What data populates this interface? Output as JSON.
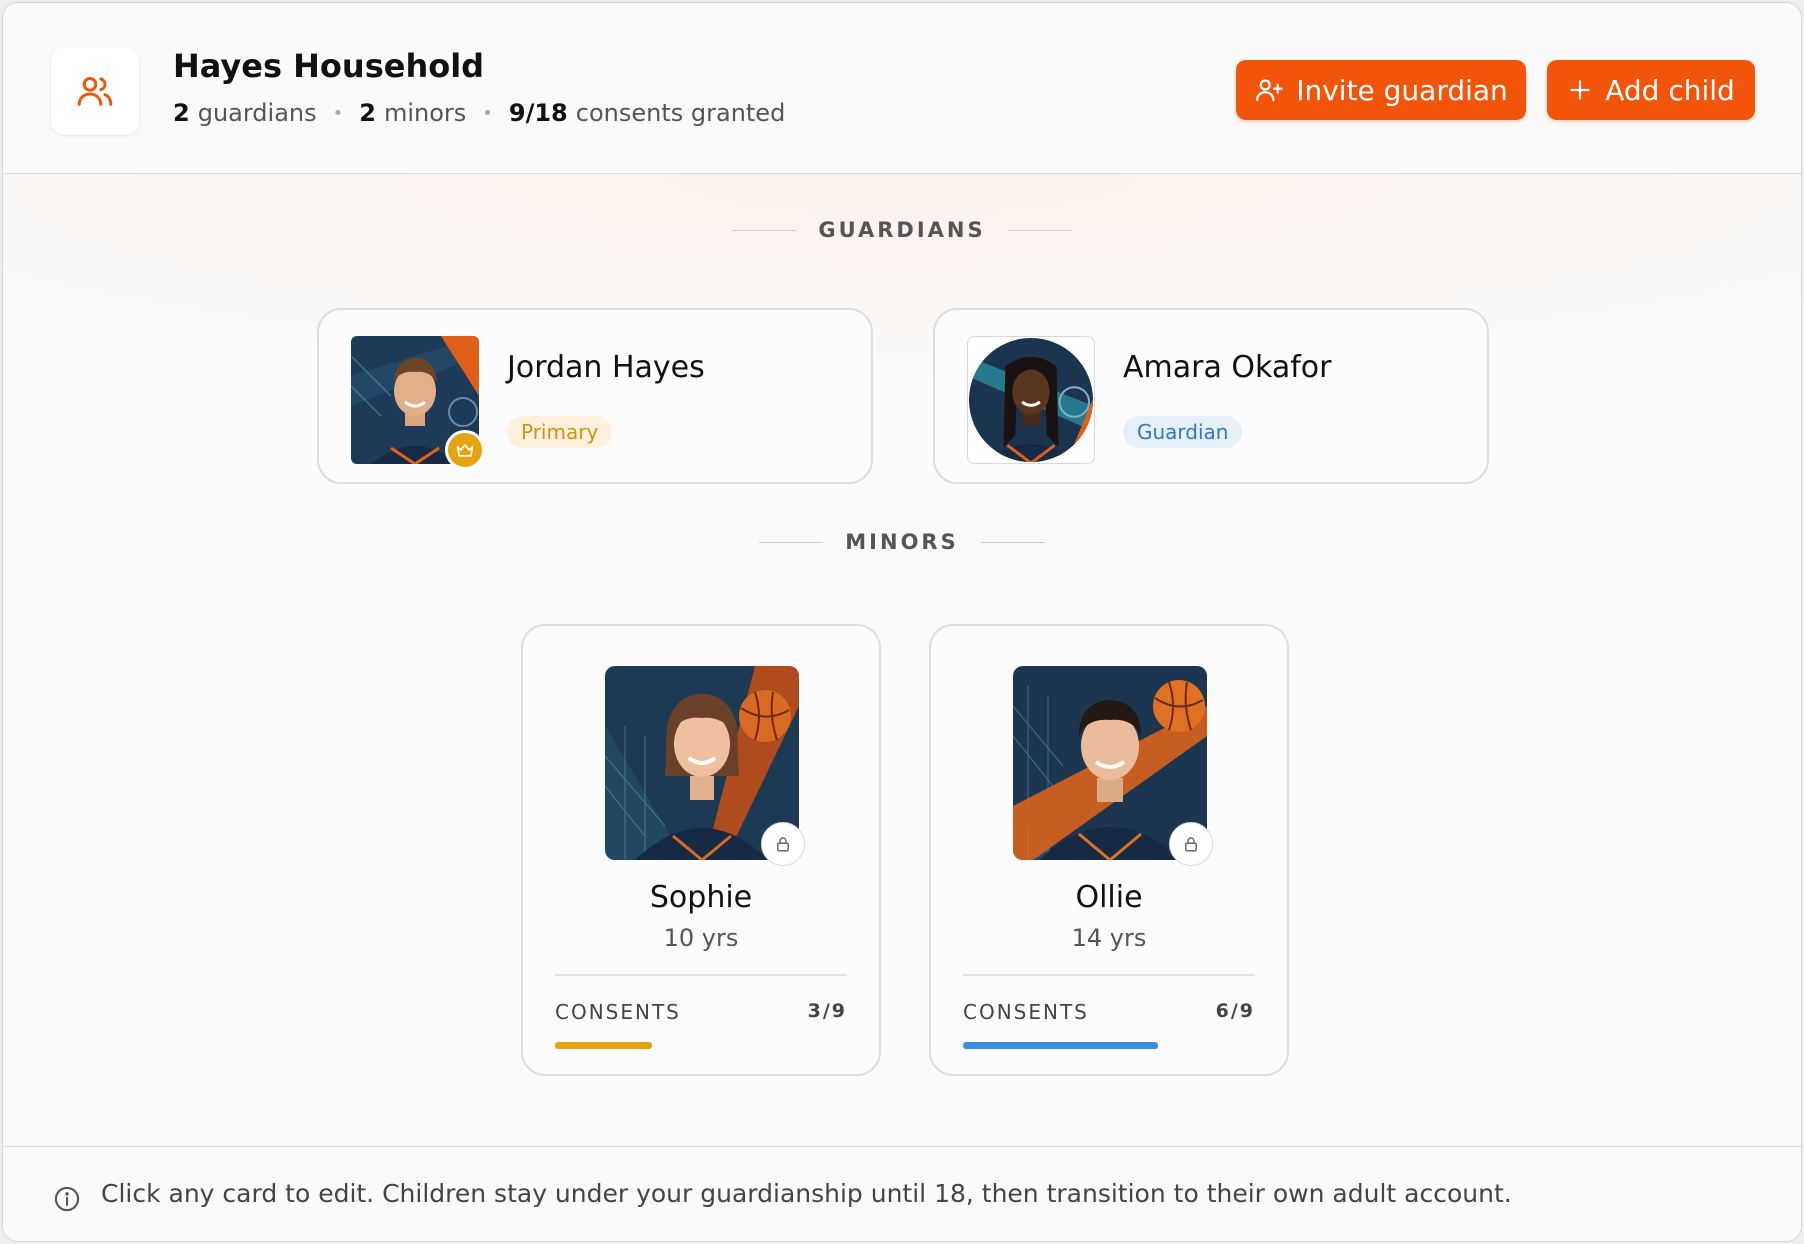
{
  "household": {
    "title": "Hayes Household",
    "guardians_count": "2",
    "guardians_word": "guardians",
    "minors_count": "2",
    "minors_word": "minors",
    "consents_value": "9/18",
    "consents_word": "consents granted",
    "icon": "users-icon"
  },
  "actions": {
    "invite_label": "Invite guardian",
    "add_label": "Add child"
  },
  "sections": {
    "guardians": "GUARDIANS",
    "minors": "MINORS"
  },
  "guardians": [
    {
      "name": "Jordan Hayes",
      "role": "Primary",
      "is_primary": true
    },
    {
      "name": "Amara Okafor",
      "role": "Guardian",
      "is_primary": false
    }
  ],
  "minors": [
    {
      "name": "Sophie",
      "age": "10 yrs",
      "consents_label": "CONSENTS",
      "consents": "3/9",
      "granted": 3,
      "total": 9,
      "bar_color": "#e5a40e"
    },
    {
      "name": "Ollie",
      "age": "14 yrs",
      "consents_label": "CONSENTS",
      "consents": "6/9",
      "granted": 6,
      "total": 9,
      "bar_color": "#3a8ee0"
    }
  ],
  "footer": {
    "note": "Click any card to edit. Children stay under your guardianship until 18, then transition to their own adult account."
  },
  "colors": {
    "accent": "#f2540a",
    "primary_badge": "#d4900e",
    "guardian_badge": "#2f78c4"
  }
}
